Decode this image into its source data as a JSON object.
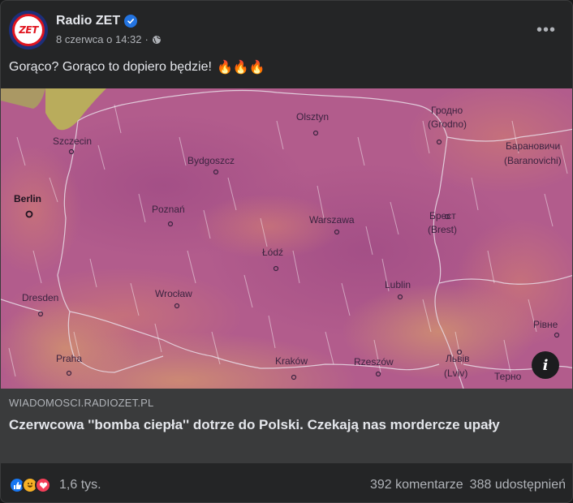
{
  "post": {
    "page_name": "Radio ZET",
    "avatar_text": "ZET",
    "verified": true,
    "timestamp": "8 czerwca o 14:32",
    "separator": "·",
    "caption": "Gorąco? Gorąco to dopiero będzie!",
    "caption_emojis": "🔥🔥🔥"
  },
  "map": {
    "cities": {
      "szczecin": "Szczecin",
      "olsztyn": "Olsztyn",
      "grodno": "Гродно",
      "grodno_pl": "(Grodno)",
      "baranovichi": "Барановичи",
      "baranovichi_lat": "(Baranovichi)",
      "bydgoszcz": "Bydgoszcz",
      "berlin": "Berlin",
      "poznan": "Poznań",
      "warszawa": "Warszawa",
      "brest": "Брест",
      "brest_lat": "(Brest)",
      "lodz": "Łódź",
      "wroclaw": "Wrocław",
      "lublin": "Lublin",
      "dresden": "Dresden",
      "rivne": "Рівне",
      "praha": "Praha",
      "krakow": "Kraków",
      "rzeszow": "Rzeszów",
      "lviv": "Львів",
      "lviv_lat": "(Lviv)",
      "ternopil": "Терно"
    },
    "info_label": "i"
  },
  "link": {
    "domain": "WIADOMOSCI.RADIOZET.PL",
    "title": "Czerwcowa ''bomba ciepła'' dotrze do Polski. Czekają nas mordercze upały"
  },
  "footer": {
    "reaction_count": "1,6 tys.",
    "comments": "392 komentarze",
    "shares": "388 udostępnień"
  },
  "colors": {
    "background": "#242526",
    "link_box": "#3a3b3c",
    "verified": "#2374e1",
    "map_heat": "#b05a8a"
  }
}
